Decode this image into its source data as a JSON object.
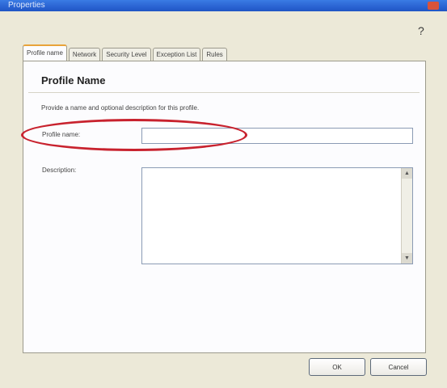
{
  "window": {
    "title": "Properties"
  },
  "help_glyph": "?",
  "tabs": [
    {
      "label": "Profile name",
      "active": true
    },
    {
      "label": "Network",
      "active": false
    },
    {
      "label": "Security Level",
      "active": false
    },
    {
      "label": "Exception List",
      "active": false
    },
    {
      "label": "Rules",
      "active": false
    }
  ],
  "panel": {
    "heading": "Profile Name",
    "description": "Provide a name and optional description for this profile.",
    "name_label": "Profile name:",
    "name_value": "",
    "description_label": "Description:",
    "description_value": ""
  },
  "buttons": {
    "ok": "OK",
    "cancel": "Cancel"
  },
  "colors": {
    "highlight": "#c8222e",
    "titlebar": "#2a63d2",
    "active_tab_accent": "#e8a33a"
  }
}
